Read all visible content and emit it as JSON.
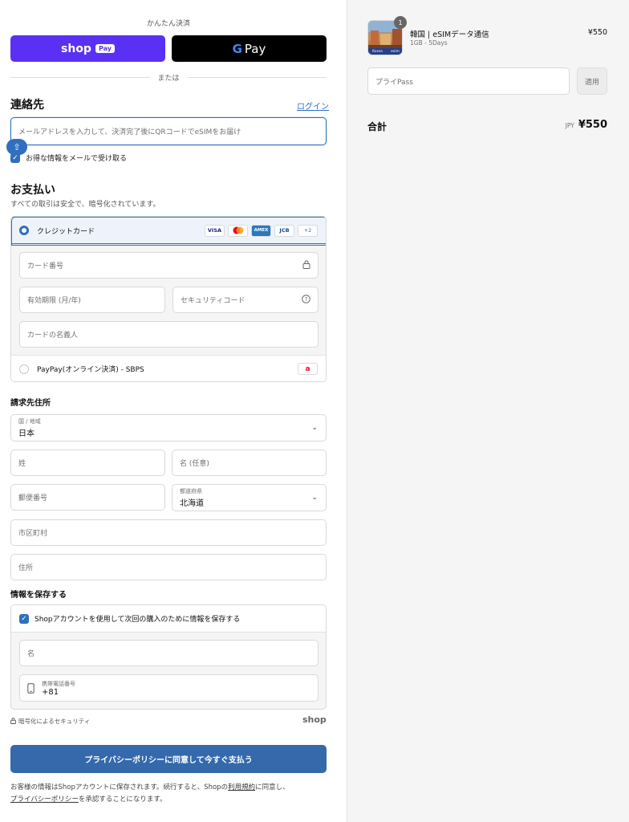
{
  "express": {
    "label": "かんたん決済",
    "shop_pay_word": "shop",
    "shop_pay_box": "Pay",
    "gpay_word": "Pay",
    "divider": "または"
  },
  "contact": {
    "title": "連絡先",
    "login": "ログイン",
    "email_placeholder": "メールアドレスを入力して、決済完了後にQRコードでeSIMをお届け",
    "marketing_label": "お得な情報をメールで受け取る",
    "marketing_checked": true
  },
  "payment": {
    "title": "お支払い",
    "subtitle": "すべての取引は安全で、暗号化されています。",
    "credit_card_label": "クレジットカード",
    "card_logos": [
      "VISA",
      "MC",
      "AMEX",
      "JCB",
      "+2"
    ],
    "card_number_placeholder": "カード番号",
    "expiry_placeholder": "有効期限 (月/年)",
    "cvc_placeholder": "セキュリティコード",
    "name_placeholder": "カードの名義人",
    "paypay_label": "PayPay(オンライン決済) - SBPS",
    "paypay_logo": "a"
  },
  "billing": {
    "title": "請求先住所",
    "country_label": "国 / 地域",
    "country_value": "日本",
    "last_name": "姓",
    "first_name": "名 (任意)",
    "postal": "郵便番号",
    "prefecture_label": "都道府県",
    "prefecture_value": "北海道",
    "city": "市区町村",
    "address": "住所"
  },
  "save": {
    "title": "情報を保存する",
    "shop_account_label": "Shopアカウントを使用して次回の購入のために情報を保存する",
    "name_placeholder": "名",
    "phone_label": "携帯電話番号",
    "phone_value": "+81"
  },
  "footer": {
    "secure_text": "暗号化によるセキュリティ",
    "shop_word": "shop",
    "pay_button": "プライバシーポリシーに同意して今すぐ支払う",
    "legal_1": "お客様の情報はShopアカウントに保存されます。続行すると、Shopの",
    "legal_terms": "利用規約",
    "legal_2": "に同意し、",
    "legal_privacy": "プライバシーポリシー",
    "legal_3": "を承認することになります。"
  },
  "summary": {
    "qty_badge": "1",
    "product_name": "韓国 | eSIMデータ通信",
    "product_variant": "1GB - 5Days",
    "product_price": "¥550",
    "thumb_band": [
      "Korea",
      "esim"
    ],
    "discount_placeholder": "プライPass",
    "apply_label": "適用",
    "total_label": "合計",
    "total_currency": "JPY",
    "total_amount": "¥550"
  },
  "colors": {
    "shop_pay": "#5a31f4",
    "primary": "#3469ab",
    "focus": "#2f6fbd"
  }
}
